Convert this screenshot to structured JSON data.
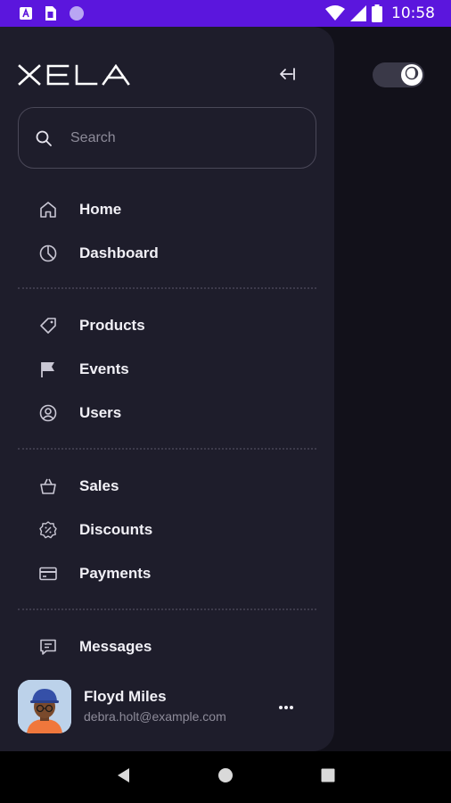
{
  "status_bar": {
    "time": "10:58",
    "icons": [
      "app-a-icon",
      "sim-card-icon",
      "circle-notification-icon",
      "wifi-icon",
      "signal-icon",
      "battery-icon"
    ],
    "background": "#5b16dd"
  },
  "theme_toggle": {
    "state": "dark",
    "icon": "moon-icon"
  },
  "drawer": {
    "logo_text": "XELA",
    "collapse_icon": "collapse-left-icon",
    "search": {
      "placeholder": "Search",
      "value": ""
    },
    "groups": [
      [
        {
          "label": "Home",
          "icon": "home-icon"
        },
        {
          "label": "Dashboard",
          "icon": "pie-chart-icon"
        }
      ],
      [
        {
          "label": "Products",
          "icon": "tag-icon"
        },
        {
          "label": "Events",
          "icon": "flag-icon"
        },
        {
          "label": "Users",
          "icon": "user-circle-icon"
        }
      ],
      [
        {
          "label": "Sales",
          "icon": "basket-icon"
        },
        {
          "label": "Discounts",
          "icon": "discount-badge-icon"
        },
        {
          "label": "Payments",
          "icon": "credit-card-icon"
        }
      ],
      [
        {
          "label": "Messages",
          "icon": "message-icon"
        }
      ]
    ],
    "profile": {
      "name": "Floyd Miles",
      "email": "debra.holt@example.com",
      "more_icon": "more-horizontal-icon"
    }
  },
  "system_nav": {
    "icons": [
      "back-icon",
      "home-circle-icon",
      "recents-icon"
    ]
  },
  "colors": {
    "drawer_bg": "#1e1d2b",
    "page_bg": "#12111a",
    "text_primary": "#f1f0f6",
    "text_secondary": "#8d8b99",
    "border": "#4a4858"
  }
}
